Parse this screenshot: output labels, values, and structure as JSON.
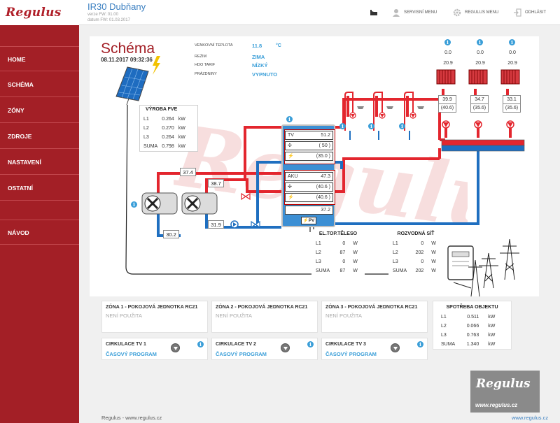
{
  "brand": {
    "logo": "Regulus"
  },
  "header": {
    "title": "IR30 Dubňany",
    "version": "verze FW: 01.00",
    "date": "datum FW: 01.03.2017",
    "service_menu": "SERVISNÍ MENU",
    "regulus_menu": "REGULUS MENU",
    "logout": "ODHLÁSIT"
  },
  "sidebar": {
    "items": [
      {
        "label": "HOME"
      },
      {
        "label": "SCHÉMA"
      },
      {
        "label": "ZÓNY"
      },
      {
        "label": "ZDROJE"
      },
      {
        "label": "NASTAVENÍ"
      },
      {
        "label": "OSTATNÍ"
      },
      {
        "label": "NÁVOD"
      }
    ]
  },
  "schema": {
    "title": "Schéma",
    "datetime": "08.11.2017 09:32:36",
    "status": {
      "outdoor_label": "VENKOVNÍ TEPLOTA",
      "outdoor_value": "11.8",
      "outdoor_unit": "°C",
      "mode_label": "REŽIM",
      "mode_value": "ZIMA",
      "hdo_label": "HDO TARIF",
      "hdo_value": "NÍZKÝ",
      "holiday_label": "PRÁZDNINY",
      "holiday_value": "VYPNUTO"
    },
    "fve": {
      "title": "VÝROBA FVE",
      "rows": [
        {
          "name": "L1",
          "value": "0.264",
          "unit": "kW"
        },
        {
          "name": "L2",
          "value": "0.270",
          "unit": "kW"
        },
        {
          "name": "L3",
          "value": "0.264",
          "unit": "kW"
        },
        {
          "name": "SUMA",
          "value": "0.798",
          "unit": "kW"
        }
      ]
    },
    "pipes": {
      "hp_supply": "37.4",
      "hp2_supply": "38.7",
      "hp_return": "30.2",
      "return2": "31.9"
    },
    "tank": {
      "tv_label": "TV",
      "tv_value": "51.2",
      "tv_set": "( 50 )",
      "tv_heater": "(35.0 )",
      "aku_label": "AKU",
      "aku_value": "47.3",
      "aku_set": "(40.6 )",
      "aku_heater": "(40.6 )",
      "bottom_value": "37.2",
      "pv_label": "PV"
    },
    "radiators": [
      {
        "power": "0.0",
        "temp": "20.9",
        "value": "39.9",
        "set": "(40.6)"
      },
      {
        "power": "0.0",
        "temp": "20.9",
        "value": "34.7",
        "set": "(35.6)"
      },
      {
        "power": "0.0",
        "temp": "20.9",
        "value": "33.1",
        "set": "(35.6)"
      }
    ],
    "el_heater": {
      "title": "EL.TOP.TĚLESO",
      "rows": [
        {
          "name": "L1",
          "value": "0",
          "unit": "W"
        },
        {
          "name": "L2",
          "value": "87",
          "unit": "W"
        },
        {
          "name": "L3",
          "value": "0",
          "unit": "W"
        },
        {
          "name": "SUMA",
          "value": "87",
          "unit": "W"
        }
      ]
    },
    "grid": {
      "title": "ROZVODNÁ SÍŤ",
      "rows": [
        {
          "name": "L1",
          "value": "0",
          "unit": "W"
        },
        {
          "name": "L2",
          "value": "202",
          "unit": "W"
        },
        {
          "name": "L3",
          "value": "0",
          "unit": "W"
        },
        {
          "name": "SUMA",
          "value": "202",
          "unit": "W"
        }
      ]
    }
  },
  "zones": [
    {
      "title": "ZÓNA 1 - POKOJOVÁ JEDNOTKA RC21",
      "status": "NENÍ POUŽITA"
    },
    {
      "title": "ZÓNA 2 - POKOJOVÁ JEDNOTKA RC21",
      "status": "NENÍ POUŽITA"
    },
    {
      "title": "ZÓNA 3 - POKOJOVÁ JEDNOTKA RC21",
      "status": "NENÍ POUŽITA"
    }
  ],
  "circulation": [
    {
      "title": "CIRKULACE TV 1",
      "status": "ČASOVÝ PROGRAM"
    },
    {
      "title": "CIRKULACE TV 2",
      "status": "ČASOVÝ PROGRAM"
    },
    {
      "title": "CIRKULACE TV 3",
      "status": "ČASOVÝ PROGRAM"
    }
  ],
  "consumption": {
    "title": "SPOTŘEBA OBJEKTU",
    "rows": [
      {
        "name": "L1",
        "value": "0.511",
        "unit": "kW"
      },
      {
        "name": "L2",
        "value": "0.066",
        "unit": "kW"
      },
      {
        "name": "L3",
        "value": "0.763",
        "unit": "kW"
      },
      {
        "name": "SUMA",
        "value": "1.340",
        "unit": "kW"
      }
    ]
  },
  "footer": {
    "left": "Regulus - www.regulus.cz",
    "right": "www.regulus.cz",
    "brand_logo": "Regulus",
    "brand_url": "www.regulus.cz"
  },
  "colors": {
    "brand_red": "#a31f26",
    "accent_blue": "#3a9ed8",
    "hot_pipe": "#e3262e",
    "cold_pipe": "#1f6fc0"
  }
}
